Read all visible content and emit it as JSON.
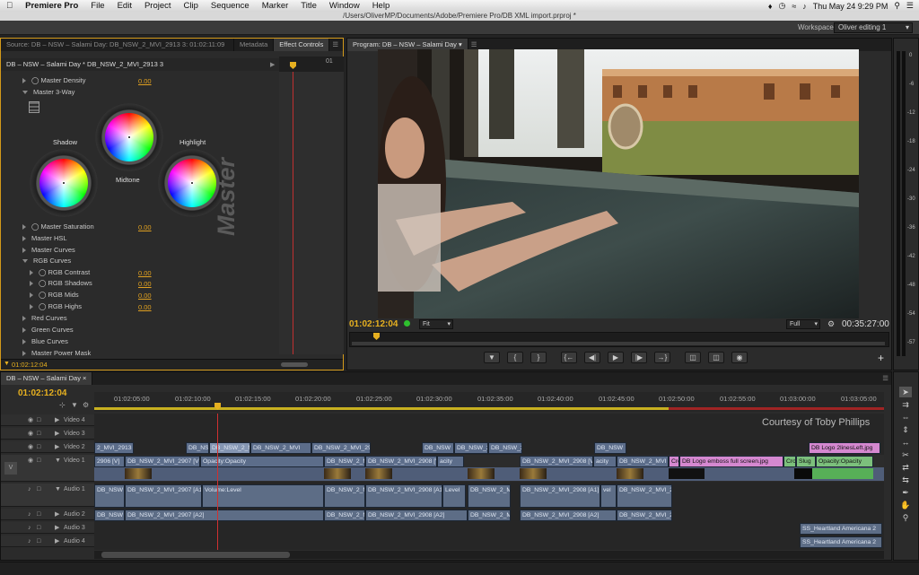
{
  "menubar": {
    "app": "Premiere Pro",
    "items": [
      "File",
      "Edit",
      "Project",
      "Clip",
      "Sequence",
      "Marker",
      "Title",
      "Window",
      "Help"
    ],
    "clock": "Thu May 24  9:29 PM"
  },
  "window_title": "/Users/OliverMP/Documents/Adobe/Premiere Pro/DB XML import.prproj *",
  "workspace": {
    "label": "Workspace:",
    "value": "Oliver editing 1"
  },
  "source_panel": {
    "tabs": [
      "Source: DB – NSW – Salami Day: DB_NSW_2_MVI_2913 3: 01:02:11:09",
      "Metadata",
      "Effect Controls"
    ],
    "header": "DB – NSW – Salami Day * DB_NSW_2_MVI_2913 3",
    "mini_ruler_label": "01",
    "params": [
      {
        "label": "Master Density",
        "value": "0.00"
      },
      {
        "label": "Master 3-Way",
        "value": ""
      },
      {
        "label": "Master Saturation",
        "value": "0.00"
      },
      {
        "label": "Master HSL",
        "value": ""
      },
      {
        "label": "Master Curves",
        "value": ""
      },
      {
        "label": "RGB Curves",
        "value": ""
      },
      {
        "label": "RGB Contrast",
        "value": "0.00"
      },
      {
        "label": "RGB Shadows",
        "value": "0.00"
      },
      {
        "label": "RGB Mids",
        "value": "0.00"
      },
      {
        "label": "RGB Highs",
        "value": "0.00"
      },
      {
        "label": "Red Curves",
        "value": ""
      },
      {
        "label": "Green Curves",
        "value": ""
      },
      {
        "label": "Blue Curves",
        "value": ""
      },
      {
        "label": "Master Power Mask",
        "value": ""
      }
    ],
    "wheels": {
      "shadow": "Shadow",
      "midtone": "Midtone",
      "highlight": "Highlight",
      "big_label": "Master"
    },
    "timecode": "01:02:12:04"
  },
  "program": {
    "tab": "Program: DB – NSW – Salami Day",
    "timecode": "01:02:12:04",
    "fit": "Fit",
    "quality": "Full",
    "duration": "00:35:27:00"
  },
  "audio_meter": {
    "labels": [
      "0",
      "-6",
      "-12",
      "-18",
      "-24",
      "-30",
      "-36",
      "-42",
      "-48",
      "-54",
      "-57"
    ]
  },
  "timeline": {
    "tab": "DB – NSW – Salami Day",
    "timecode": "01:02:12:04",
    "ruler": [
      "01:02:05:00",
      "01:02:10:00",
      "01:02:15:00",
      "01:02:20:00",
      "01:02:25:00",
      "01:02:30:00",
      "01:02:35:00",
      "01:02:40:00",
      "01:02:45:00",
      "01:02:50:00",
      "01:02:55:00",
      "01:03:00:00",
      "01:03:05:00"
    ],
    "tracks": [
      "Video 4",
      "Video 3",
      "Video 2",
      "Video 1",
      "Audio 1",
      "Audio 2",
      "Audio 3",
      "Audio 4"
    ],
    "target": "V",
    "overlay_text": "Courtesy of Toby Phillips",
    "v2_clips": [
      "2_MVI_2913",
      "DB_NS",
      "DB_NSW_2_M",
      "DB_NSW_2_MVI",
      "DB_NSW_2_MVI_2913",
      "DB_NSW",
      "DB_NSW_2",
      "DB_NSW_2",
      "DB_NSW",
      "DB Logo 2linesLeft.jpg"
    ],
    "v1_clips": [
      "2906 [V]",
      "DB_NSW_2_MVI_2907 [V]",
      "Opacity:Opacity",
      "DB_NSW_2_M",
      "DB_NSW_2_MVI_2908 [V]",
      "acity",
      "DB_NSW_2_MVI_2908 [V]",
      "acity",
      "DB_NSW_2_MVI",
      "Cro",
      "DB Logo emboss full screen.jpg",
      "Cro",
      "Slug",
      "Opacity:Opacity"
    ],
    "a1_clips": [
      "DB_NSW",
      "DB_NSW_2_MVI_2907 [A1]",
      "Volume:Level",
      "DB_NSW_2_M",
      "DB_NSW_2_MVI_2908 [A1]",
      "Level",
      "DB_NSW_2_M",
      "DB_NSW_2_MVI_2908 [A1]",
      "vel",
      "DB_NSW_2_MVI_2"
    ],
    "a2_clips": [
      "DB_NSW",
      "DB_NSW_2_MVI_2907 [A2]",
      "DB_NSW_2_M",
      "DB_NSW_2_MVI_2908 [A2]",
      "DB_NSW_2_M",
      "DB_NSW_2_MVI_2908 [A2]",
      "DB_NSW_2_MVI_2"
    ],
    "a3_clips": [
      "SS_Heartland Americana 2"
    ],
    "a4_clips": [
      "SS_Heartland Americana 2"
    ]
  },
  "colors": {
    "accent": "#e6b020",
    "playhead": "#d03030",
    "video_clip": "#5c6d8a",
    "pink_clip": "#d588d0",
    "green_clip": "#7cc07c"
  }
}
